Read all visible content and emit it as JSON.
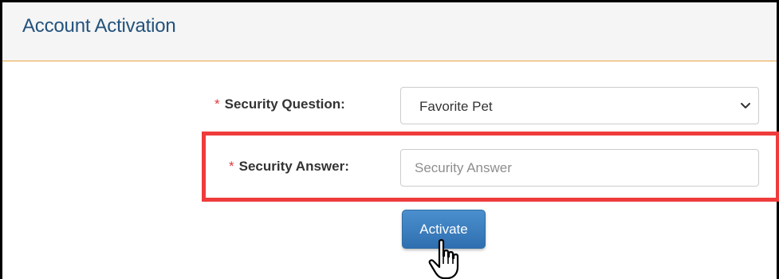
{
  "panel": {
    "title": "Account Activation"
  },
  "form": {
    "security_question": {
      "required_marker": "*",
      "label": "Security Question:",
      "selected_value": "Favorite Pet"
    },
    "security_answer": {
      "required_marker": "*",
      "label": "Security Answer:",
      "placeholder": "Security Answer",
      "value": ""
    },
    "submit": {
      "label": "Activate"
    }
  },
  "icons": {
    "dropdown": "chevron-down-icon",
    "cursor": "hand-pointer-cursor-icon"
  },
  "colors": {
    "title": "#23527c",
    "header_rule": "#e9a441",
    "required": "#e0393e",
    "highlight": "#ef3b3b",
    "button": "#337ab7"
  }
}
